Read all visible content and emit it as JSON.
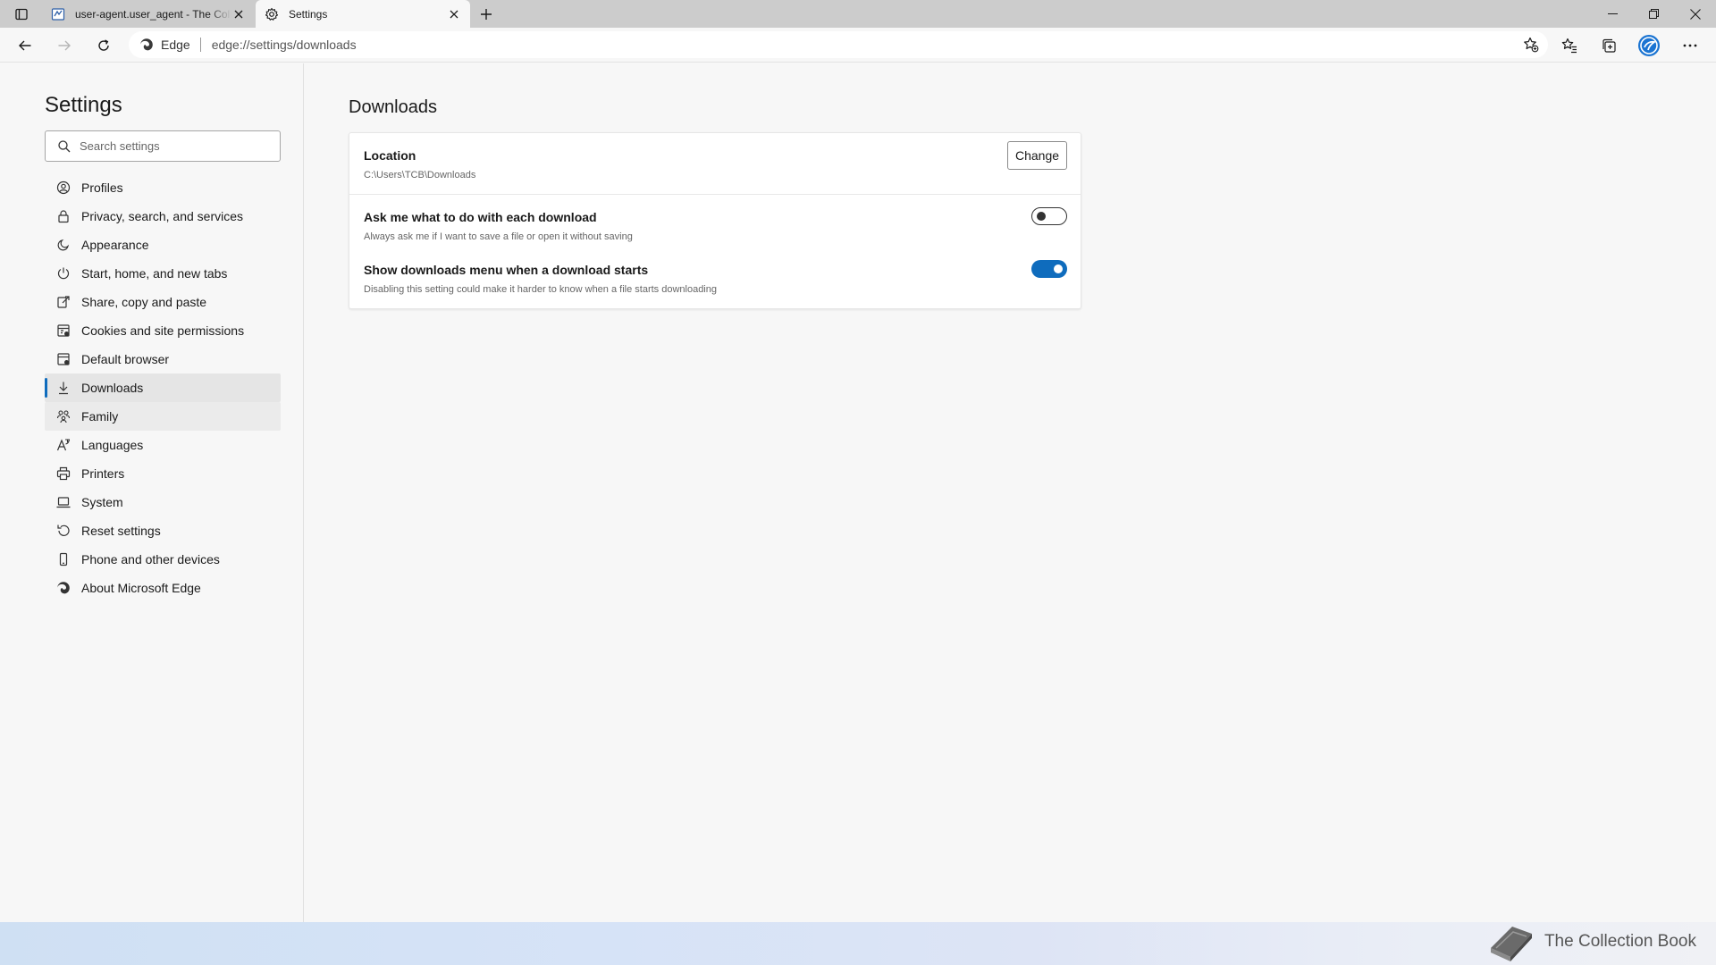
{
  "tabs": [
    {
      "title": "user-agent.user_agent - The Collection Book",
      "active": false
    },
    {
      "title": "Settings",
      "active": true
    }
  ],
  "toolbar": {
    "site_chip": "Edge",
    "url": "edge://settings/downloads"
  },
  "sidebar": {
    "title": "Settings",
    "search_placeholder": "Search settings",
    "items": [
      {
        "label": "Profiles",
        "icon": "profile-icon"
      },
      {
        "label": "Privacy, search, and services",
        "icon": "lock-icon"
      },
      {
        "label": "Appearance",
        "icon": "appearance-icon"
      },
      {
        "label": "Start, home, and new tabs",
        "icon": "power-icon"
      },
      {
        "label": "Share, copy and paste",
        "icon": "share-icon"
      },
      {
        "label": "Cookies and site permissions",
        "icon": "cookies-icon"
      },
      {
        "label": "Default browser",
        "icon": "browser-icon"
      },
      {
        "label": "Downloads",
        "icon": "download-icon",
        "selected": true
      },
      {
        "label": "Family",
        "icon": "family-icon"
      },
      {
        "label": "Languages",
        "icon": "languages-icon"
      },
      {
        "label": "Printers",
        "icon": "printer-icon"
      },
      {
        "label": "System",
        "icon": "laptop-icon"
      },
      {
        "label": "Reset settings",
        "icon": "reset-icon"
      },
      {
        "label": "Phone and other devices",
        "icon": "phone-icon"
      },
      {
        "label": "About Microsoft Edge",
        "icon": "edge-logo-icon"
      }
    ]
  },
  "main": {
    "title": "Downloads",
    "location": {
      "title": "Location",
      "path": "C:\\Users\\TCB\\Downloads",
      "button": "Change"
    },
    "ask_each": {
      "title": "Ask me what to do with each download",
      "desc": "Always ask me if I want to save a file or open it without saving",
      "enabled": false
    },
    "show_menu": {
      "title": "Show downloads menu when a download starts",
      "desc": "Disabling this setting could make it harder to know when a file starts downloading",
      "enabled": true
    }
  },
  "watermark": {
    "text": "The Collection Book"
  },
  "colors": {
    "accent": "#0f6cbd",
    "tabstrip": "#cccccc",
    "background": "#f7f7f7"
  }
}
